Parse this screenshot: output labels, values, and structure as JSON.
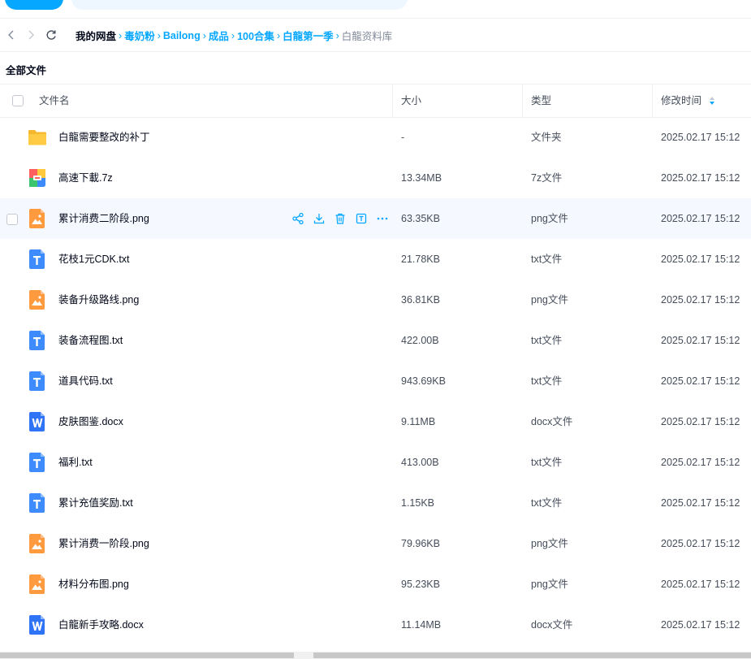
{
  "breadcrumb": {
    "root": "我的网盘",
    "items": [
      "毒奶粉",
      "Bailong",
      "成品",
      "100合集",
      "白龍第一季"
    ],
    "current": "白龍资料库"
  },
  "section_title": "全部文件",
  "columns": {
    "name": "文件名",
    "size": "大小",
    "type": "类型",
    "mtime": "修改时间"
  },
  "files": [
    {
      "name": "白龍需要整改的补丁",
      "size": "-",
      "type": "文件夹",
      "mtime": "2025.02.17 15:12",
      "icon": "folder-icon"
    },
    {
      "name": "高速下載.7z",
      "size": "13.34MB",
      "type": "7z文件",
      "mtime": "2025.02.17 15:12",
      "icon": "archive-icon"
    },
    {
      "name": "累计消费二阶段.png",
      "size": "63.35KB",
      "type": "png文件",
      "mtime": "2025.02.17 15:12",
      "icon": "image-file-icon"
    },
    {
      "name": "花枝1元CDK.txt",
      "size": "21.78KB",
      "type": "txt文件",
      "mtime": "2025.02.17 15:12",
      "icon": "text-file-icon"
    },
    {
      "name": "装备升级路线.png",
      "size": "36.81KB",
      "type": "png文件",
      "mtime": "2025.02.17 15:12",
      "icon": "image-file-icon"
    },
    {
      "name": "装备流程图.txt",
      "size": "422.00B",
      "type": "txt文件",
      "mtime": "2025.02.17 15:12",
      "icon": "text-file-icon"
    },
    {
      "name": "道具代码.txt",
      "size": "943.69KB",
      "type": "txt文件",
      "mtime": "2025.02.17 15:12",
      "icon": "text-file-icon"
    },
    {
      "name": "皮肤图鉴.docx",
      "size": "9.11MB",
      "type": "docx文件",
      "mtime": "2025.02.17 15:12",
      "icon": "word-file-icon"
    },
    {
      "name": "福利.txt",
      "size": "413.00B",
      "type": "txt文件",
      "mtime": "2025.02.17 15:12",
      "icon": "text-file-icon"
    },
    {
      "name": "累计充值奖励.txt",
      "size": "1.15KB",
      "type": "txt文件",
      "mtime": "2025.02.17 15:12",
      "icon": "text-file-icon"
    },
    {
      "name": "累计消费一阶段.png",
      "size": "79.96KB",
      "type": "png文件",
      "mtime": "2025.02.17 15:12",
      "icon": "image-file-icon"
    },
    {
      "name": "材料分布图.png",
      "size": "95.23KB",
      "type": "png文件",
      "mtime": "2025.02.17 15:12",
      "icon": "image-file-icon"
    },
    {
      "name": "白龍新手攻略.docx",
      "size": "11.14MB",
      "type": "docx文件",
      "mtime": "2025.02.17 15:12",
      "icon": "word-file-icon"
    }
  ],
  "hovered_row_index": 2,
  "row_actions": [
    "share-icon",
    "download-icon",
    "delete-icon",
    "rename-icon",
    "more-icon"
  ],
  "colors": {
    "accent": "#06a7ff",
    "folder": "#ffc93d",
    "image": "#ff9a3e",
    "text": "#3d8bfd",
    "word": "#2f73f6"
  }
}
